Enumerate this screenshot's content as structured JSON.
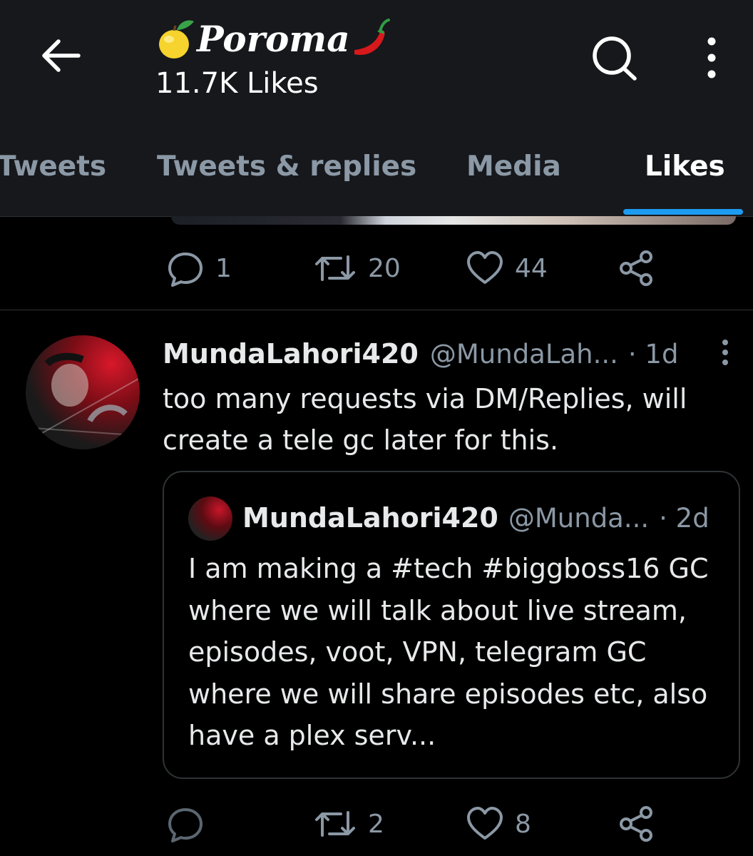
{
  "header": {
    "profile_name": "Poroma",
    "likes_count": "11.7K Likes",
    "name_emoji_left": "lemon-emoji",
    "name_emoji_right": "hot-pepper-emoji"
  },
  "tabs": [
    {
      "label": "Tweets",
      "active": false
    },
    {
      "label": "Tweets & replies",
      "active": false
    },
    {
      "label": "Media",
      "active": false
    },
    {
      "label": "Likes",
      "active": true
    }
  ],
  "prev_tweet": {
    "replies": "1",
    "retweets": "20",
    "likes": "44"
  },
  "tweet": {
    "author_name": "MundaLahori420",
    "handle": "@MundaLah...",
    "time": "· 1d",
    "text": "too many requests via DM/Replies, will create a tele gc later for this.",
    "replies": "",
    "retweets": "2",
    "likes": "8",
    "quote": {
      "author_name": "MundaLahori420",
      "handle": "@Munda...",
      "time": "· 2d",
      "text": "I am making a #tech #biggboss16 GC where we will talk about live stream, episodes, voot, VPN, telegram GC where we will share episodes etc, also have a plex serv..."
    }
  },
  "colors": {
    "background": "#000000",
    "header_bg": "#16181c",
    "accent": "#1d9bf0",
    "muted": "#8b98a5",
    "text": "#e7e9ea"
  }
}
